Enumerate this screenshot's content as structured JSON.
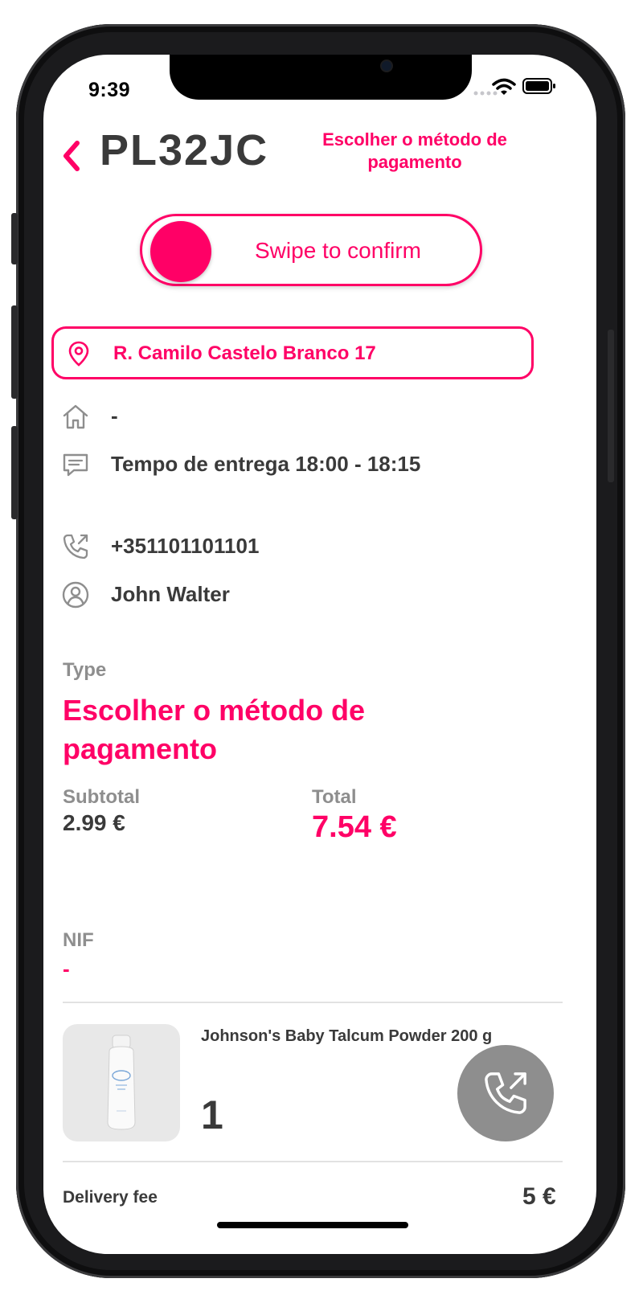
{
  "status_bar": {
    "time": "9:39"
  },
  "header": {
    "back_icon": "chevron-left-icon",
    "plate": "PL32JC",
    "payment_method_link": "Escolher o método de pagamento"
  },
  "swipe": {
    "label": "Swipe to confirm"
  },
  "address": {
    "icon": "location-pin-icon",
    "text": "R. Camilo Castelo Branco 17"
  },
  "details": {
    "home": {
      "icon": "home-icon",
      "text": "-"
    },
    "delivery_time": {
      "icon": "message-icon",
      "text": "Tempo de entrega 18:00 - 18:15"
    },
    "phone": {
      "icon": "phone-icon",
      "text": "+351101101101"
    },
    "customer": {
      "icon": "user-icon",
      "text": "John Walter"
    }
  },
  "type": {
    "label": "Type",
    "value": "Escolher o método de pagamento"
  },
  "totals": {
    "subtotal_label": "Subtotal",
    "subtotal_value": "2.99 €",
    "total_label": "Total",
    "total_value": "7.54 €"
  },
  "nif": {
    "label": "NIF",
    "value": "-"
  },
  "product": {
    "name": "Johnson's Baby Talcum Powder 200 g",
    "quantity": "1"
  },
  "delivery_fee": {
    "label": "Delivery fee",
    "value": "5 €"
  },
  "colors": {
    "accent": "#ff0066",
    "text": "#3a3a3a",
    "muted": "#8e8e8e",
    "fab": "#8e8e8e"
  }
}
